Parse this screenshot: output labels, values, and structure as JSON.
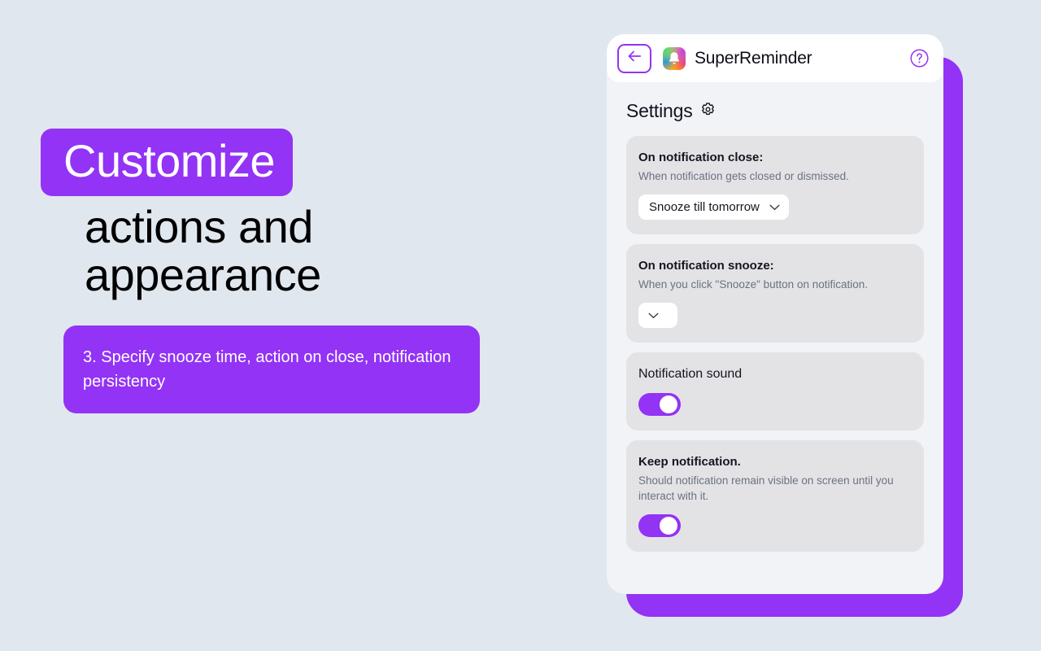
{
  "theme": {
    "accent": "#9333f5",
    "page_bg": "#e1e7ee",
    "panel_bg": "#f2f3f6",
    "card_bg": "#e3e3e6",
    "text": "#15151f",
    "muted_text": "#6b7280"
  },
  "promo": {
    "headline_highlight": "Customize",
    "headline_rest": "actions and appearance",
    "caption": "3. Specify snooze time, action on close, notification persistency"
  },
  "app": {
    "titlebar": {
      "back_icon": "arrow-left-icon",
      "app_icon": "bell-app-icon",
      "title": "SuperReminder",
      "help_icon": "question-mark-circle-icon"
    },
    "settings": {
      "heading": "Settings",
      "heading_icon": "gear-icon",
      "cards": [
        {
          "id": "on-notification-close",
          "title": "On notification close:",
          "subtitle": "When notification gets closed or dismissed.",
          "control": "select",
          "value": "Snooze till tomorrow",
          "chevron_icon": "chevron-down-icon"
        },
        {
          "id": "on-notification-snooze",
          "title": "On notification snooze:",
          "subtitle": "When you click \"Snooze\" button on notification.",
          "control": "select",
          "value": "",
          "chevron_icon": "chevron-down-icon"
        },
        {
          "id": "notification-sound",
          "title": "Notification sound",
          "subtitle": "",
          "control": "toggle",
          "value": "on"
        },
        {
          "id": "keep-notification",
          "title": "Keep notification.",
          "subtitle": "Should notification remain visible on screen until you interact with it.",
          "control": "toggle",
          "value": "on"
        }
      ]
    }
  }
}
